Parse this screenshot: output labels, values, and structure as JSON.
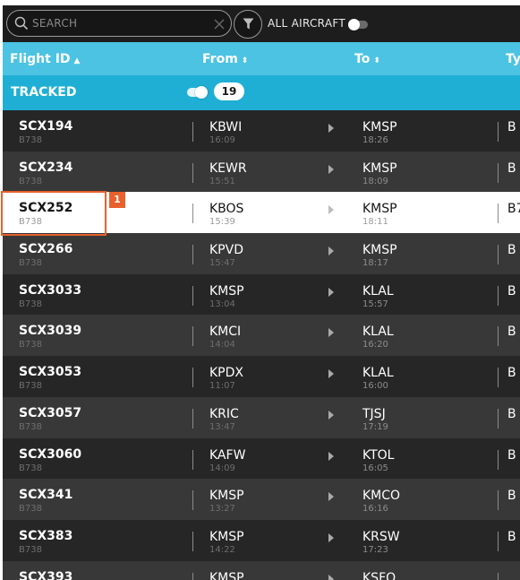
{
  "toolbar": {
    "search_placeholder": "SEARCH",
    "search_value": "",
    "all_aircraft_label": "ALL AIRCRAFT",
    "all_aircraft_toggle": "off"
  },
  "columns": {
    "flight_id": "Flight ID",
    "from": "From",
    "to": "To",
    "type_partial": "Ty",
    "sort_up": "▲",
    "sort_both": "⬍"
  },
  "tracked": {
    "label": "TRACKED",
    "toggle": "on",
    "count": "19"
  },
  "annotation": {
    "badge": "1"
  },
  "flights": [
    {
      "id": "SCX194",
      "type": "B738",
      "from": "KBWI",
      "from_time": "16:09",
      "to": "KMSP",
      "to_time": "18:26",
      "last": "B"
    },
    {
      "id": "SCX234",
      "type": "B738",
      "from": "KEWR",
      "from_time": "15:51",
      "to": "KMSP",
      "to_time": "18:09",
      "last": "B"
    },
    {
      "id": "SCX252",
      "type": "B738",
      "from": "KBOS",
      "from_time": "15:39",
      "to": "KMSP",
      "to_time": "18:11",
      "last": "B7"
    },
    {
      "id": "SCX266",
      "type": "B738",
      "from": "KPVD",
      "from_time": "15:47",
      "to": "KMSP",
      "to_time": "18:17",
      "last": "B"
    },
    {
      "id": "SCX3033",
      "type": "B738",
      "from": "KMSP",
      "from_time": "13:04",
      "to": "KLAL",
      "to_time": "15:57",
      "last": "B"
    },
    {
      "id": "SCX3039",
      "type": "B738",
      "from": "KMCI",
      "from_time": "14:04",
      "to": "KLAL",
      "to_time": "16:20",
      "last": "B"
    },
    {
      "id": "SCX3053",
      "type": "B738",
      "from": "KPDX",
      "from_time": "11:07",
      "to": "KLAL",
      "to_time": "16:00",
      "last": "B"
    },
    {
      "id": "SCX3057",
      "type": "B738",
      "from": "KRIC",
      "from_time": "13:47",
      "to": "TJSJ",
      "to_time": "17:19",
      "last": "B"
    },
    {
      "id": "SCX3060",
      "type": "B738",
      "from": "KAFW",
      "from_time": "14:09",
      "to": "KTOL",
      "to_time": "16:05",
      "last": "B"
    },
    {
      "id": "SCX341",
      "type": "B738",
      "from": "KMSP",
      "from_time": "13:27",
      "to": "KMCO",
      "to_time": "16:16",
      "last": "B"
    },
    {
      "id": "SCX383",
      "type": "B738",
      "from": "KMSP",
      "from_time": "14:22",
      "to": "KRSW",
      "to_time": "17:23",
      "last": "B"
    },
    {
      "id": "SCX393",
      "type": "",
      "from": "KMSP",
      "from_time": "",
      "to": "KSFO",
      "to_time": "",
      "last": ""
    }
  ],
  "selected_row": 2,
  "colors": {
    "header": "#4cc3e2",
    "tracked_bar": "#1fafd4",
    "highlight": "#e8602c",
    "row_dark": "#262626",
    "row_light": "#383838"
  }
}
